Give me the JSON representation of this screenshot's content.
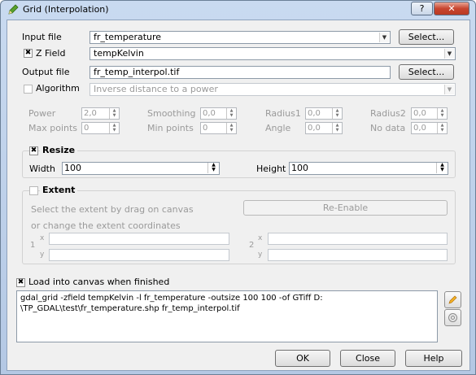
{
  "window": {
    "title": "Grid (Interpolation)",
    "help_label": "?",
    "close_label": "✕"
  },
  "input": {
    "label": "Input file",
    "value": "fr_temperature",
    "select_label": "Select..."
  },
  "zfield": {
    "label": "Z Field",
    "checked_mark": "✖",
    "value": "tempKelvin"
  },
  "output": {
    "label": "Output file",
    "value": "fr_temp_interpol.tif",
    "select_label": "Select..."
  },
  "algorithm": {
    "label": "Algorithm",
    "value": "Inverse distance to a power"
  },
  "params": {
    "power": {
      "label": "Power",
      "value": "2,0"
    },
    "smoothing": {
      "label": "Smoothing",
      "value": "0,0"
    },
    "radius1": {
      "label": "Radius1",
      "value": "0,0"
    },
    "radius2": {
      "label": "Radius2",
      "value": "0,0"
    },
    "max_points": {
      "label": "Max points",
      "value": "0"
    },
    "min_points": {
      "label": "Min points",
      "value": "0"
    },
    "angle": {
      "label": "Angle",
      "value": "0,0"
    },
    "no_data": {
      "label": "No data",
      "value": "0,0"
    }
  },
  "resize": {
    "title": "Resize",
    "checked_mark": "✖",
    "width_label": "Width",
    "width_value": "100",
    "height_label": "Height",
    "height_value": "100"
  },
  "extent": {
    "title": "Extent",
    "drag_text": "Select the extent by drag on canvas",
    "reenable_label": "Re-Enable",
    "coords_text": "or change the extent coordinates",
    "p1_label": "1",
    "p2_label": "2",
    "x_label": "x",
    "y_label": "y"
  },
  "load": {
    "label": "Load into canvas when finished",
    "checked_mark": "✖"
  },
  "command": "gdal_grid -zfield tempKelvin -l fr_temperature -outsize 100 100 -of GTiff D:\n\\TP_GDAL\\test\\fr_temperature.shp fr_temp_interpol.tif",
  "footer": {
    "ok_label": "OK",
    "close_label": "Close",
    "help_label": "Help"
  },
  "colors": {
    "title_bar": "#c9daf0",
    "close_button": "#c8452f",
    "dialog_bg": "#f0f0f0"
  }
}
